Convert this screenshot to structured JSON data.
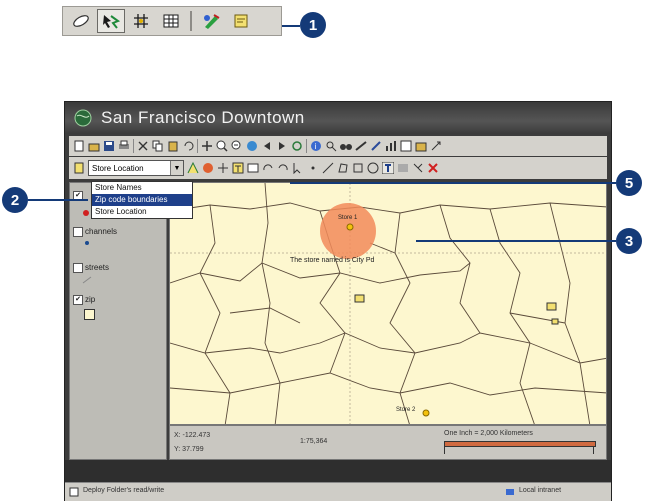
{
  "mini_toolbar": {
    "icons": [
      "eraser-icon",
      "select-map-element-icon",
      "snap-grid-icon",
      "table-grid-icon",
      "paint-icon",
      "note-icon"
    ]
  },
  "callouts": [
    "1",
    "2",
    "3",
    "5"
  ],
  "window": {
    "title": "San Francisco Downtown"
  },
  "layer_select": {
    "value": "Store Location",
    "options": [
      "Store Names",
      "Zip code boundaries",
      "Store Location"
    ],
    "selected_index": 1
  },
  "toc": {
    "layers": [
      {
        "label": "",
        "checked": true
      },
      {
        "label": "channels",
        "checked": false
      },
      {
        "label": "streets",
        "checked": false
      },
      {
        "label": "zip",
        "checked": true
      }
    ]
  },
  "map": {
    "annotation": "The store named is City Pd",
    "store_labels": [
      "Store 1",
      "Store 2"
    ],
    "colors": {
      "background": "#fdf7cf",
      "buffer": "#f28b5a",
      "boundaries": "#5a4a3a",
      "store": "#f4c20d"
    }
  },
  "status": {
    "x_coord": "X: -122.473",
    "y_coord": "Y: 37.799",
    "scale": "1:75,364",
    "scale_text": "One Inch = 2,000 Kilometers"
  },
  "statusbar": {
    "left_text": "Deploy Folder's read/write",
    "right_text": "Local intranet"
  }
}
